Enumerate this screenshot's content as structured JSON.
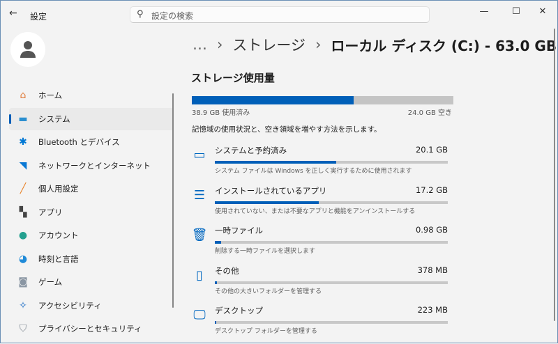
{
  "window": {
    "title": "設定",
    "back_icon": "←",
    "minimize": "—",
    "maximize": "☐",
    "close": "✕"
  },
  "search": {
    "placeholder": "設定の検索"
  },
  "sidebar": {
    "items": [
      {
        "label": "ホーム",
        "icon": "home-icon",
        "glyph": "⌂",
        "color": "#e07b39"
      },
      {
        "label": "システム",
        "icon": "system-icon",
        "glyph": "▬",
        "color": "#2a8fd0"
      },
      {
        "label": "Bluetooth とデバイス",
        "icon": "bluetooth-icon",
        "glyph": "✱",
        "color": "#0078d4"
      },
      {
        "label": "ネットワークとインターネット",
        "icon": "wifi-icon",
        "glyph": "◥",
        "color": "#0a78d4"
      },
      {
        "label": "個人用設定",
        "icon": "brush-icon",
        "glyph": "╱",
        "color": "#e8832a"
      },
      {
        "label": "アプリ",
        "icon": "apps-icon",
        "glyph": "▚",
        "color": "#444"
      },
      {
        "label": "アカウント",
        "icon": "account-icon",
        "glyph": "●",
        "color": "#23a08f"
      },
      {
        "label": "時刻と言語",
        "icon": "time-language-icon",
        "glyph": "◕",
        "color": "#1f8ad8"
      },
      {
        "label": "ゲーム",
        "icon": "game-icon",
        "glyph": "◙",
        "color": "#8a96a3"
      },
      {
        "label": "アクセシビリティ",
        "icon": "accessibility-icon",
        "glyph": "✧",
        "color": "#1468c4"
      },
      {
        "label": "プライバシーとセキュリティ",
        "icon": "shield-icon",
        "glyph": "⛉",
        "color": "#7d8791"
      }
    ]
  },
  "breadcrumb": {
    "ellipsis": "…",
    "sep": "›",
    "parent": "ストレージ",
    "current": "ローカル ディスク (C:) - 63.0 GB"
  },
  "storage": {
    "heading": "ストレージ使用量",
    "used_label": "38.9 GB 使用済み",
    "free_label": "24.0 GB 空き",
    "used_fraction": 0.618,
    "description": "記憶域の使用状況と、空き領域を増やす方法を示します。",
    "categories": [
      {
        "label": "システムと予約済み",
        "size": "20.1 GB",
        "desc": "システム ファイルは Windows を正しく実行するために使用されます",
        "fraction": 0.52,
        "icon": "laptop-icon",
        "glyph": "▭"
      },
      {
        "label": "インストールされているアプリ",
        "size": "17.2 GB",
        "desc": "使用されていない、または不要なアプリと機能をアンインストールする",
        "fraction": 0.445,
        "icon": "list-icon",
        "glyph": "☰"
      },
      {
        "label": "一時ファイル",
        "size": "0.98 GB",
        "desc": "削除する一時ファイルを選択します",
        "fraction": 0.027,
        "icon": "trash-icon",
        "glyph": "🗑"
      },
      {
        "label": "その他",
        "size": "378 MB",
        "desc": "その他の大きいフォルダーを管理する",
        "fraction": 0.01,
        "icon": "folder-icon",
        "glyph": "▯"
      },
      {
        "label": "デスクトップ",
        "size": "223 MB",
        "desc": "デスクトップ フォルダーを管理する",
        "fraction": 0.006,
        "icon": "desktop-icon",
        "glyph": "🖵"
      }
    ]
  }
}
